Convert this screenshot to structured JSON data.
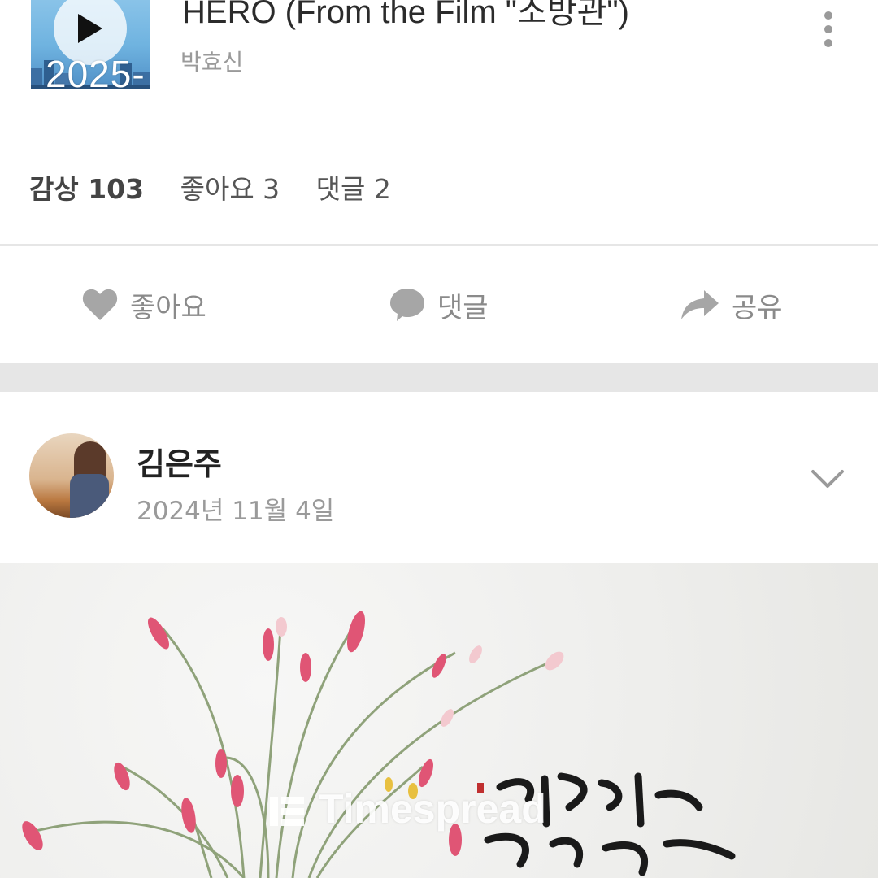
{
  "music": {
    "title": "HERO (From the Film \"소방관\")",
    "artist": "박효신",
    "overlay_date": "2025-"
  },
  "stats": {
    "views": "감상 103",
    "likes": "좋아요 3",
    "comments": "댓글 2"
  },
  "actions": {
    "like": "좋아요",
    "comment": "댓글",
    "share": "공유"
  },
  "post": {
    "author": "김은주",
    "date": "2024년 11월 4일"
  },
  "watermark": "Timespread",
  "colors": {
    "icon_gray": "#a6a6a6",
    "section_gap": "#e6e6e6",
    "album_blue": "#6fb3e0"
  }
}
